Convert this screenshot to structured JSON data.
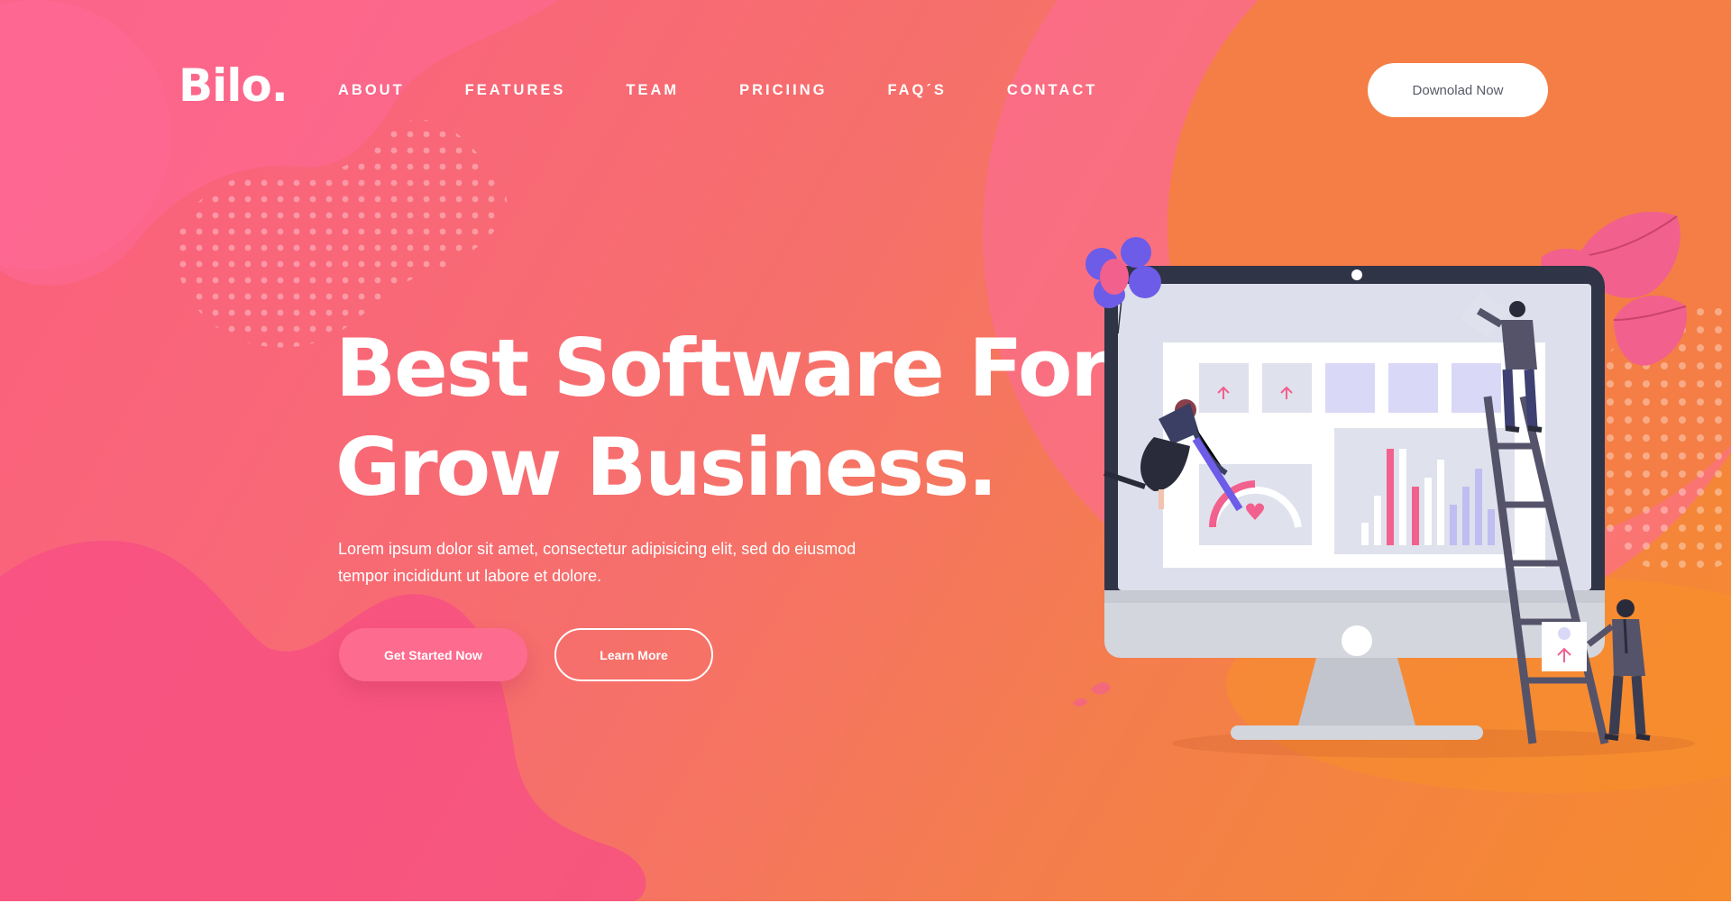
{
  "brand": {
    "logo_text": "Bilo."
  },
  "nav": {
    "items": [
      {
        "label": "ABOUT"
      },
      {
        "label": "FEATURES"
      },
      {
        "label": "TEAM"
      },
      {
        "label": "PRICIING"
      },
      {
        "label": "FAQ´S"
      },
      {
        "label": "CONTACT"
      }
    ],
    "download_label": "Downolad Now"
  },
  "hero": {
    "headline_line1": "Best Software For",
    "headline_line2": "Grow Business.",
    "subtext": "Lorem ipsum dolor sit amet, consectetur adipisicing elit, sed do eiusmod tempor incididunt ut labore et dolore.",
    "primary_button": "Get Started Now",
    "secondary_button": "Learn More"
  },
  "colors": {
    "gradient_start": "#fb5f7c",
    "gradient_end": "#f58a2e",
    "blob_pink": "#f74d84",
    "primary_button": "#fd6b8e",
    "monitor_dark": "#2f3447",
    "accent_purple": "#6d5ce8"
  },
  "icons": [
    "dot-pattern",
    "balloons-icon",
    "leaves-icon",
    "monitor-illustration",
    "people-illustration"
  ]
}
